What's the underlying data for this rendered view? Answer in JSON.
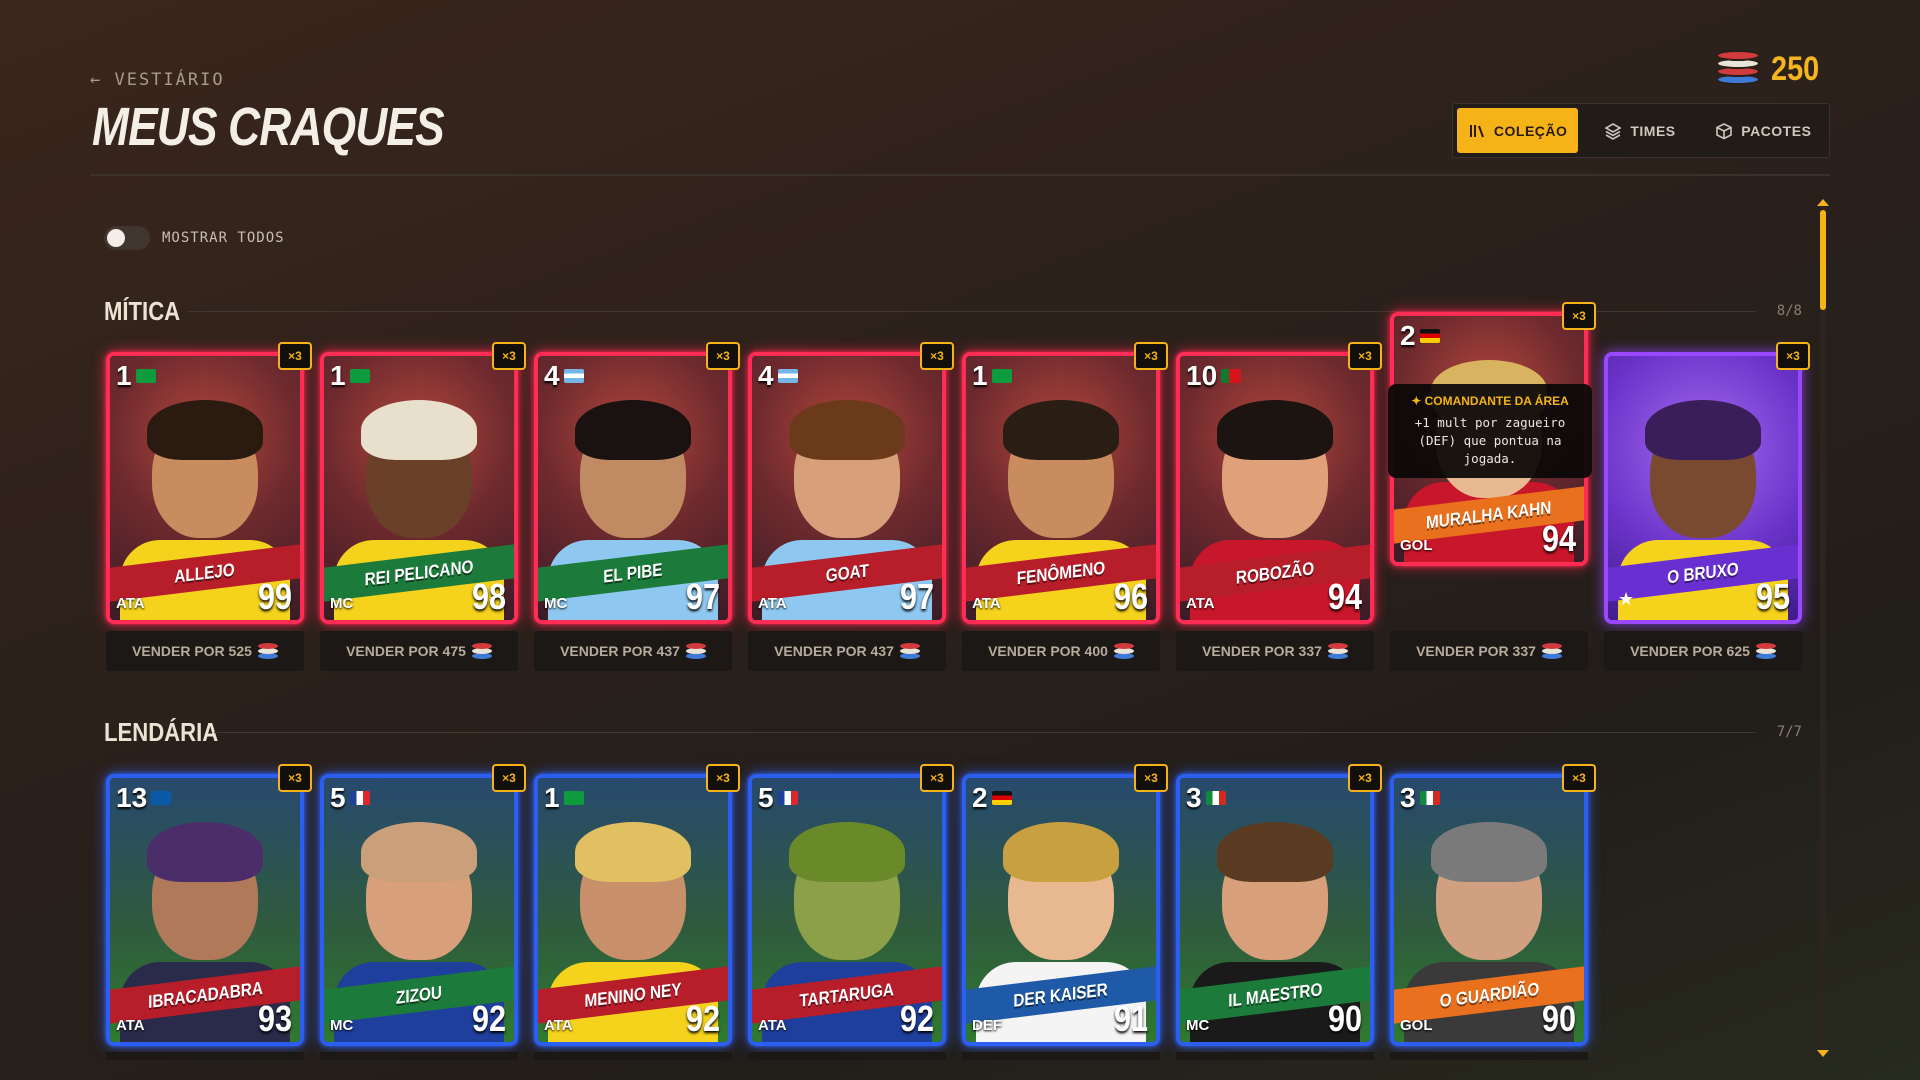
{
  "header": {
    "back_label": "← VESTIÁRIO",
    "title": "MEUS CRAQUES",
    "coins": "250"
  },
  "tabs": [
    {
      "label": "COLEÇÃO",
      "icon": "library-icon",
      "active": true
    },
    {
      "label": "TIMES",
      "icon": "layers-icon",
      "active": false
    },
    {
      "label": "PACOTES",
      "icon": "box-icon",
      "active": false
    }
  ],
  "toggle": {
    "label": "MOSTRAR TODOS",
    "on": false
  },
  "sections": [
    {
      "title": "MÍTICA",
      "count": "8/8",
      "cards": [
        {
          "number": "1",
          "country": "brazil-flag",
          "name": "ALLEJO",
          "position": "ATA",
          "rating": "99",
          "mult": "×3",
          "sell": "VENDER POR 525"
        },
        {
          "number": "1",
          "country": "brazil-flag",
          "name": "REI PELICANO",
          "position": "MC",
          "rating": "98",
          "mult": "×3",
          "sell": "VENDER POR 475"
        },
        {
          "number": "4",
          "country": "argentina-flag",
          "name": "EL PIBE",
          "position": "MC",
          "rating": "97",
          "mult": "×3",
          "sell": "VENDER POR 437"
        },
        {
          "number": "4",
          "country": "argentina-flag",
          "name": "GOAT",
          "position": "ATA",
          "rating": "97",
          "mult": "×3",
          "sell": "VENDER POR 437"
        },
        {
          "number": "1",
          "country": "brazil-flag",
          "name": "FENÔMENO",
          "position": "ATA",
          "rating": "96",
          "mult": "×3",
          "sell": "VENDER POR 400"
        },
        {
          "number": "10",
          "country": "portugal-flag",
          "name": "ROBOZÃO",
          "position": "ATA",
          "rating": "94",
          "mult": "×3",
          "sell": "VENDER POR 337"
        },
        {
          "number": "2",
          "country": "germany-flag",
          "name": "MURALHA KAHN",
          "position": "GOL",
          "rating": "94",
          "mult": "×3",
          "sell": "VENDER POR 337"
        },
        {
          "number": "",
          "country": "",
          "name": "O BRUXO",
          "position": "★",
          "rating": "95",
          "mult": "×3",
          "sell": "VENDER POR 625"
        }
      ]
    },
    {
      "title": "LENDÁRIA",
      "count": "7/7",
      "cards": [
        {
          "number": "13",
          "country": "sweden-flag",
          "name": "IBRACADABRA",
          "position": "ATA",
          "rating": "93",
          "mult": "×3"
        },
        {
          "number": "5",
          "country": "france-flag",
          "name": "ZIZOU",
          "position": "MC",
          "rating": "92",
          "mult": "×3"
        },
        {
          "number": "1",
          "country": "brazil-flag",
          "name": "MENINO NEY",
          "position": "ATA",
          "rating": "92",
          "mult": "×3"
        },
        {
          "number": "5",
          "country": "france-flag",
          "name": "TARTARUGA",
          "position": "ATA",
          "rating": "92",
          "mult": "×3"
        },
        {
          "number": "2",
          "country": "germany-flag",
          "name": "DER KAISER",
          "position": "DEF",
          "rating": "91",
          "mult": "×3"
        },
        {
          "number": "3",
          "country": "italy-flag",
          "name": "IL MAESTRO",
          "position": "MC",
          "rating": "90",
          "mult": "×3"
        },
        {
          "number": "3",
          "country": "italy-flag",
          "name": "O GUARDIÃO",
          "position": "GOL",
          "rating": "90",
          "mult": "×3"
        }
      ]
    }
  ],
  "tooltip": {
    "title": "✦ COMANDANTE DA ÁREA",
    "body": "+1 mult por zagueiro (DEF) que pontua na jogada."
  },
  "colors": {
    "accent": "#f5b318",
    "mitica_border": "#ff2c55",
    "lendaria_border": "#2c5ff0",
    "especial_border": "#9a48ff"
  }
}
